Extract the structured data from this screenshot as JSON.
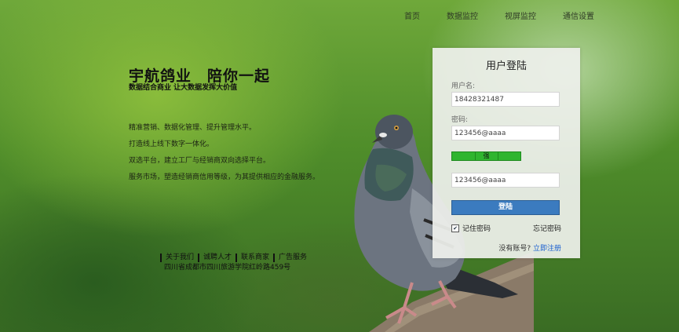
{
  "nav": {
    "items": [
      "首页",
      "数据监控",
      "视屏监控",
      "通信设置"
    ]
  },
  "hero": {
    "title": "宇航鸽业　陪你一起",
    "subtitle": "数据结合商业 让大数据发挥大价值",
    "features": [
      "精准营销、数据化管理、提升管理水平。",
      "打造线上线下数字一体化。",
      "双选平台，建立工厂与经销商双向选择平台。",
      "服务市场，塑造经销商信用等级，为其提供相应的金融服务。"
    ]
  },
  "footer": {
    "links": [
      "关于我们",
      "诚聘人才",
      "联系商家",
      "广告服务"
    ],
    "address": "四川省成都市四川旅游学院红岭路459号"
  },
  "login": {
    "title": "用户登陆",
    "username_label": "用户名:",
    "username_value": "18428321487",
    "password_label": "密码:",
    "password_value": "123456@aaaa",
    "strength_label": "强",
    "confirm_value": "123456@aaaa",
    "login_button": "登陆",
    "remember_label": "记住密码",
    "remember_checked": true,
    "forgot_label": "忘记密码",
    "no_account_text": "没有账号?",
    "register_link": "立即注册"
  },
  "colors": {
    "accent_button": "#3b7bbf",
    "strength_bar": "#2fb52f",
    "link": "#1a5fd0"
  },
  "icons": [
    "checkbox-icon",
    "pigeon-image"
  ]
}
